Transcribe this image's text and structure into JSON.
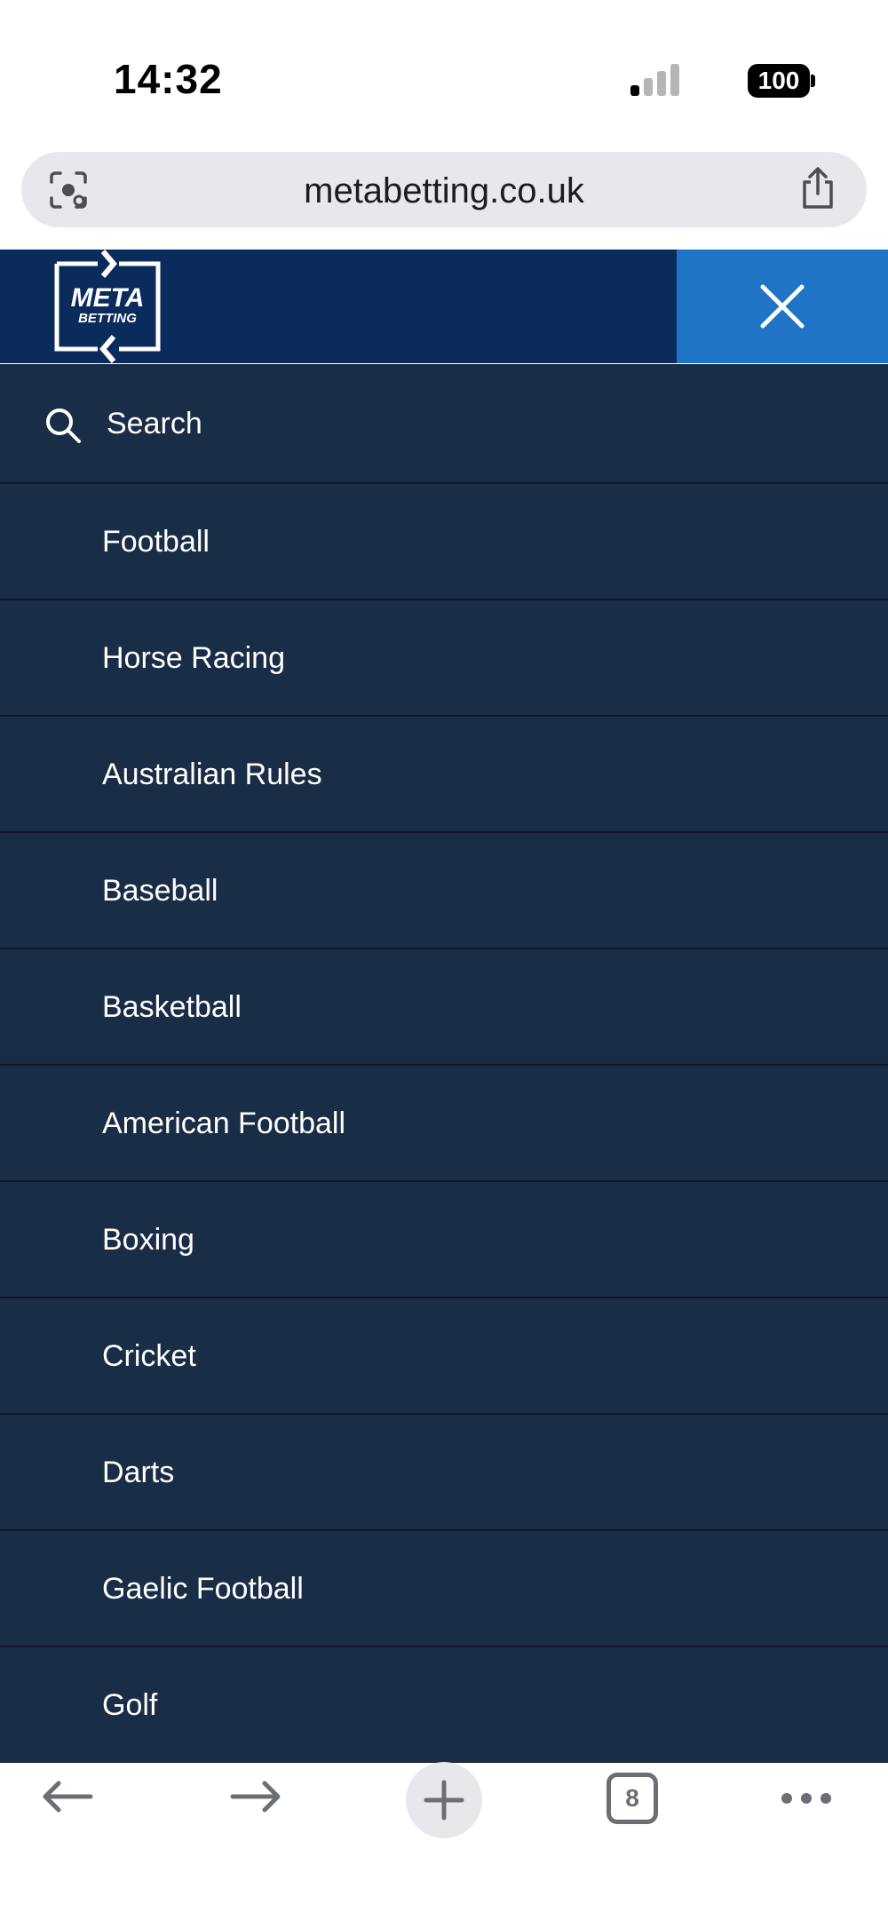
{
  "status_bar": {
    "time": "14:32",
    "battery": "100",
    "icons": [
      "signal-icon",
      "wifi-icon",
      "battery-icon"
    ]
  },
  "browser": {
    "url": "metabetting.co.uk",
    "tab_count": "8",
    "icons": [
      "lens-icon",
      "share-icon",
      "back-arrow-icon",
      "forward-arrow-icon",
      "plus-icon",
      "more-icon"
    ]
  },
  "site": {
    "logo_line1": "META",
    "logo_line2": "BETTING",
    "close_icon": "close-icon"
  },
  "menu": {
    "search_label": "Search",
    "items": [
      "Football",
      "Horse Racing",
      "Australian Rules",
      "Baseball",
      "Basketball",
      "American Football",
      "Boxing",
      "Cricket",
      "Darts",
      "Gaelic Football",
      "Golf"
    ]
  },
  "colors": {
    "header_bg": "#0a2b5c",
    "close_bg": "#1f74c5",
    "menu_bg": "#1a2d47",
    "divider": "#0c1829",
    "text": "#ffffff"
  }
}
